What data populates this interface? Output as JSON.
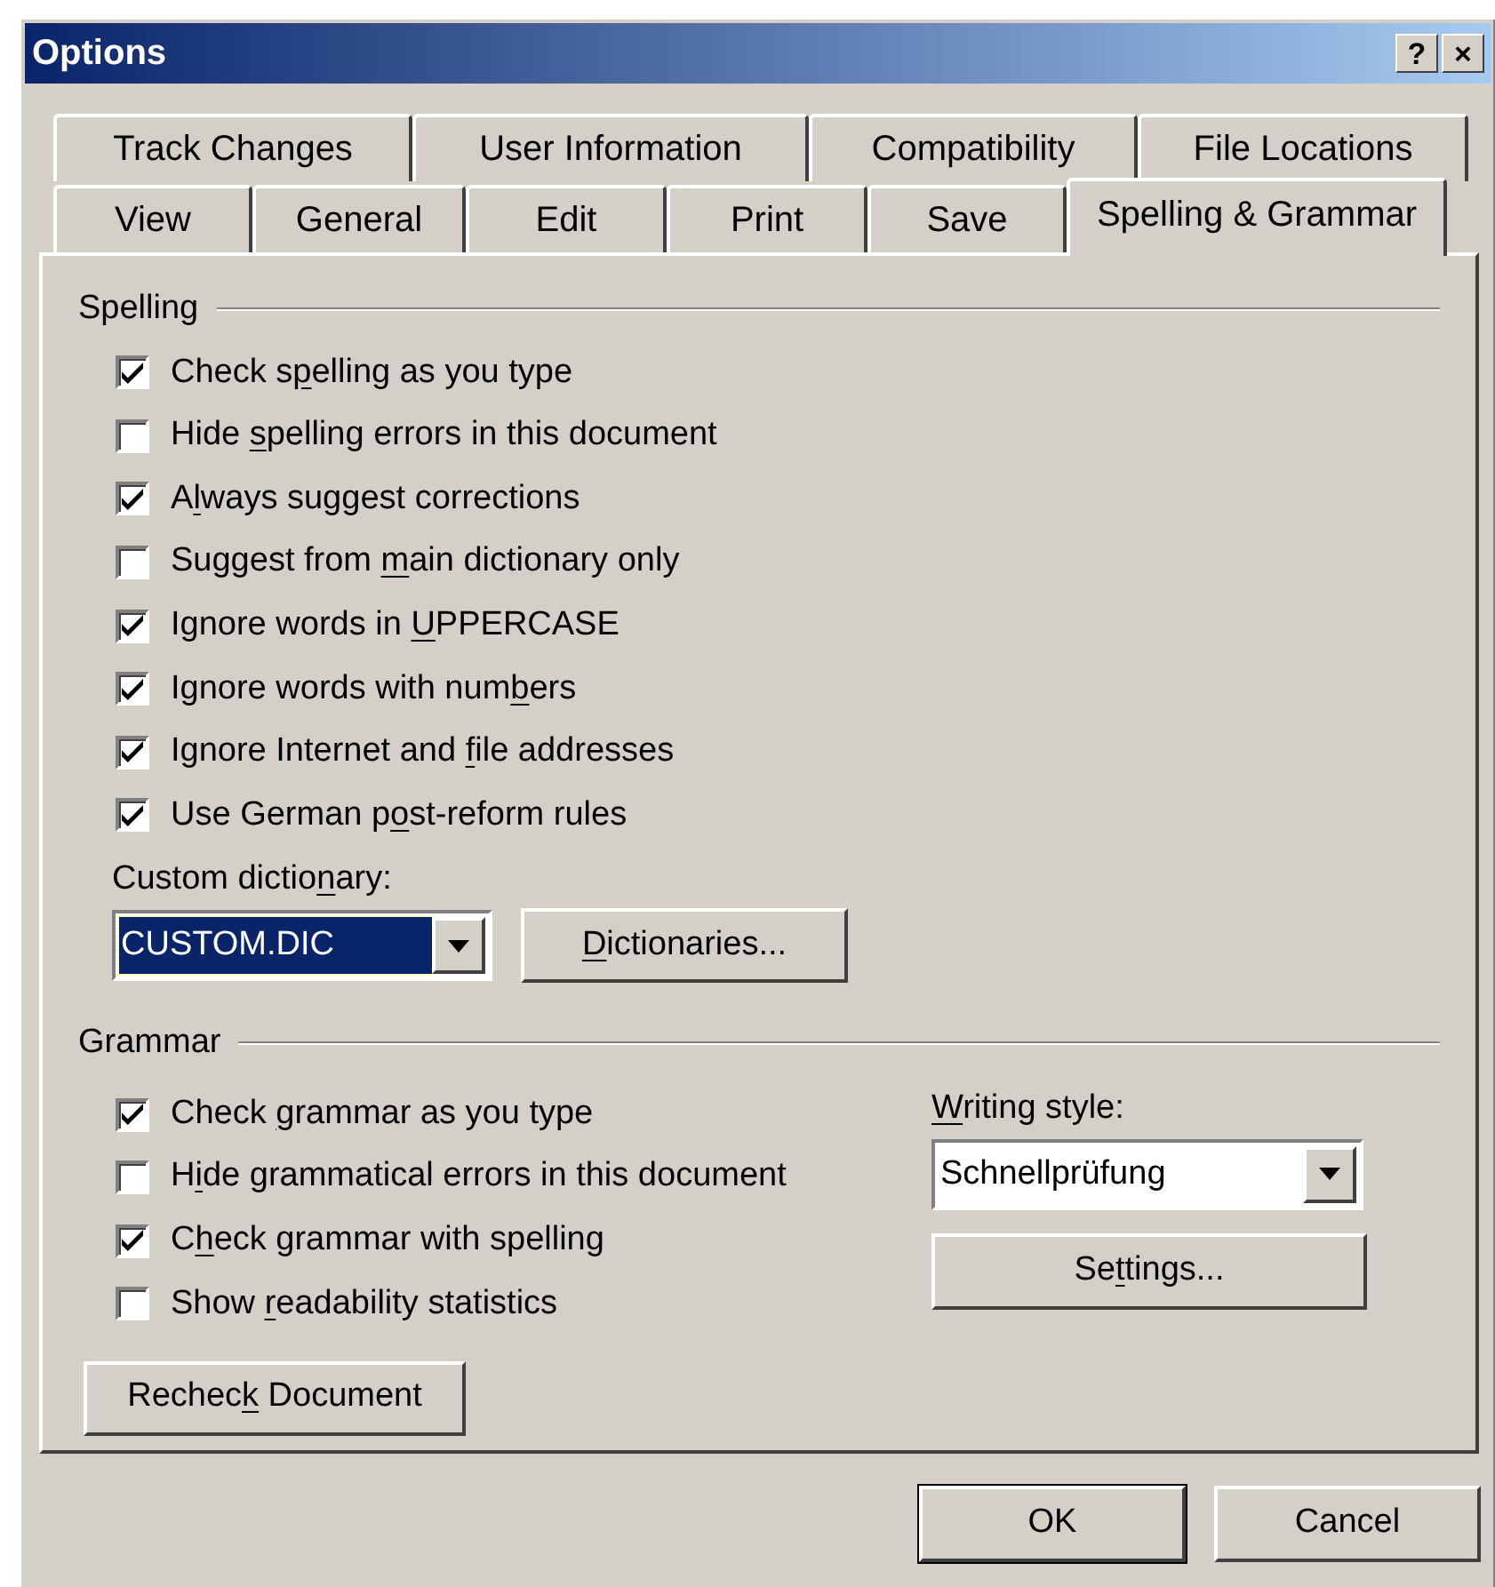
{
  "window": {
    "title": "Options",
    "title_buttons": [
      "?",
      "×"
    ]
  },
  "tab_rows": [
    [
      {
        "label": "Track Changes",
        "selected": false
      },
      {
        "label": "User Information",
        "selected": false
      },
      {
        "label": "Compatibility",
        "selected": false
      },
      {
        "label": "File Locations",
        "selected": false
      }
    ],
    [
      {
        "label": "View",
        "selected": false
      },
      {
        "label": "General",
        "selected": false
      },
      {
        "label": "Edit",
        "selected": false
      },
      {
        "label": "Print",
        "selected": false
      },
      {
        "label": "Save",
        "selected": false
      },
      {
        "label": "Spelling & Grammar",
        "selected": true
      }
    ]
  ],
  "spelling": {
    "heading": "Spelling",
    "options": [
      {
        "label": [
          "Check s",
          {
            "key": "p"
          },
          "elling as you type"
        ],
        "checked": true
      },
      {
        "label": [
          "Hide ",
          {
            "key": "s"
          },
          "pelling errors in this document"
        ],
        "checked": false
      },
      {
        "label": [
          "A",
          {
            "key": "l"
          },
          "ways suggest corrections"
        ],
        "checked": true
      },
      {
        "label": [
          "Suggest from ",
          {
            "key": "m"
          },
          "ain dictionary only"
        ],
        "checked": false
      },
      {
        "label": [
          "Ignore words in ",
          {
            "key": "U"
          },
          "PPERCASE"
        ],
        "checked": true
      },
      {
        "label": [
          "Ignore words with num",
          {
            "key": "b"
          },
          "ers"
        ],
        "checked": true
      },
      {
        "label": [
          "Ignore Internet and ",
          {
            "key": "f"
          },
          "ile addresses"
        ],
        "checked": true
      },
      {
        "label": [
          "Use German p",
          {
            "key": "o"
          },
          "st-reform rules"
        ],
        "checked": true
      }
    ],
    "custom_dictionary": {
      "label": [
        "Custom dictio",
        {
          "key": "n"
        },
        "ary:"
      ],
      "value": "CUSTOM.DIC",
      "focused": true
    },
    "dictionaries_button": [
      {
        "key": "D"
      },
      "ictionaries..."
    ]
  },
  "grammar": {
    "heading": "Grammar",
    "options": [
      {
        "label": [
          "Check ",
          {
            "key": "g"
          },
          "rammar as you type"
        ],
        "checked": true
      },
      {
        "label": [
          "H",
          {
            "key": "i"
          },
          "de grammatical errors in this document"
        ],
        "checked": false
      },
      {
        "label": [
          "C",
          {
            "key": "h"
          },
          "eck grammar with spelling"
        ],
        "checked": true
      },
      {
        "label": [
          "Show ",
          {
            "key": "r"
          },
          "eadability statistics"
        ],
        "checked": false
      }
    ],
    "writing_style": {
      "label": [
        {
          "key": "W"
        },
        "riting style:"
      ],
      "value": "Schnellprüfung",
      "focused": false
    },
    "settings_button": [
      "Se",
      {
        "key": "t"
      },
      "tings..."
    ],
    "recheck_button": [
      "Rechec",
      {
        "key": "k"
      },
      " Document"
    ]
  },
  "buttons": [
    "OK",
    "Cancel"
  ]
}
